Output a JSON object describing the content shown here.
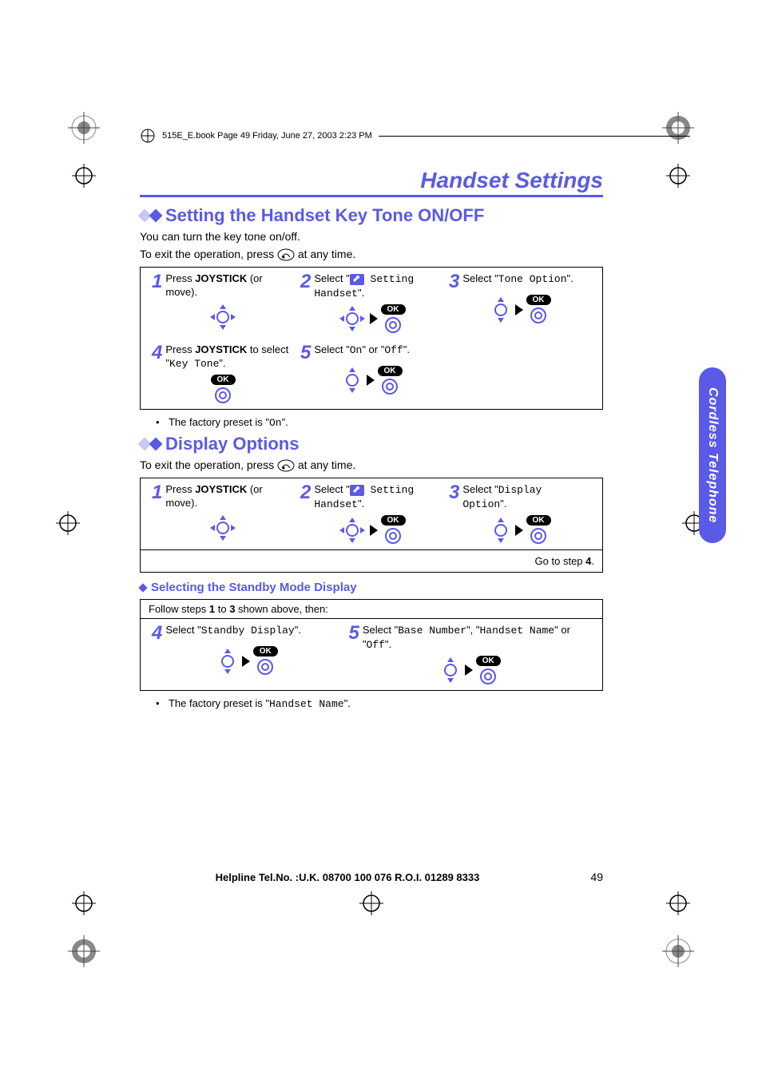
{
  "meta_line": "515E_E.book  Page 49  Friday, June 27, 2003  2:23 PM",
  "page_title": "Handset Settings",
  "side_tab": "Cordless Telephone",
  "section1": {
    "heading": "Setting the Handset Key Tone ON/OFF",
    "intro1": "You can turn the key tone on/off.",
    "intro2_pre": "To exit the operation, press ",
    "intro2_post": " at any time.",
    "steps": [
      {
        "num": "1",
        "pre": "Press ",
        "bold": "JOYSTICK",
        "post": " (or move)."
      },
      {
        "num": "2",
        "full_pre": "Select \"",
        "mono": " Setting Handset",
        "full_post": "\"."
      },
      {
        "num": "3",
        "full_pre": "Select \"",
        "mono": "Tone Option",
        "full_post": "\"."
      },
      {
        "num": "4",
        "pre": "Press ",
        "bold": "JOYSTICK",
        "post": " to select \"",
        "mono": "Key Tone",
        "post2": "\"."
      },
      {
        "num": "5",
        "full_pre": "Select \"",
        "mono": "On",
        "mid": "\" or \"",
        "mono2": "Off",
        "full_post": "\"."
      }
    ],
    "bullet_pre": "The factory preset is \"",
    "bullet_mono": "On",
    "bullet_post": "\"."
  },
  "section2": {
    "heading": "Display Options",
    "intro_pre": "To exit the operation, press ",
    "intro_post": " at any time.",
    "steps": [
      {
        "num": "1",
        "pre": "Press ",
        "bold": "JOYSTICK",
        "post": " (or move)."
      },
      {
        "num": "2",
        "full_pre": "Select \"",
        "mono": " Setting Handset",
        "full_post": "\"."
      },
      {
        "num": "3",
        "full_pre": "Select \"",
        "mono": "Display Option",
        "full_post": "\"."
      }
    ],
    "goto_pre": "Go to step ",
    "goto_bold": "4",
    "goto_post": "."
  },
  "section3": {
    "heading": "Selecting the Standby Mode Display",
    "follow_pre": "Follow steps ",
    "follow_b1": "1",
    "follow_mid": " to ",
    "follow_b2": "3",
    "follow_post": " shown above, then:",
    "steps": [
      {
        "num": "4",
        "full_pre": "Select \"",
        "mono": "Standby Display",
        "full_post": "\"."
      },
      {
        "num": "5",
        "full_pre": "Select \"",
        "mono": "Base Number",
        "mid": "\", \"",
        "mono2": "Handset Name",
        "mid2": "\" or \"",
        "mono3": "Off",
        "full_post": "\"."
      }
    ],
    "bullet_pre": "The factory preset is \"",
    "bullet_mono": "Handset Name",
    "bullet_post": "\"."
  },
  "footer": {
    "helpline": "Helpline Tel.No. :U.K. 08700 100 076  R.O.I. 01289 8333",
    "pageno": "49"
  },
  "ok_label": "OK"
}
